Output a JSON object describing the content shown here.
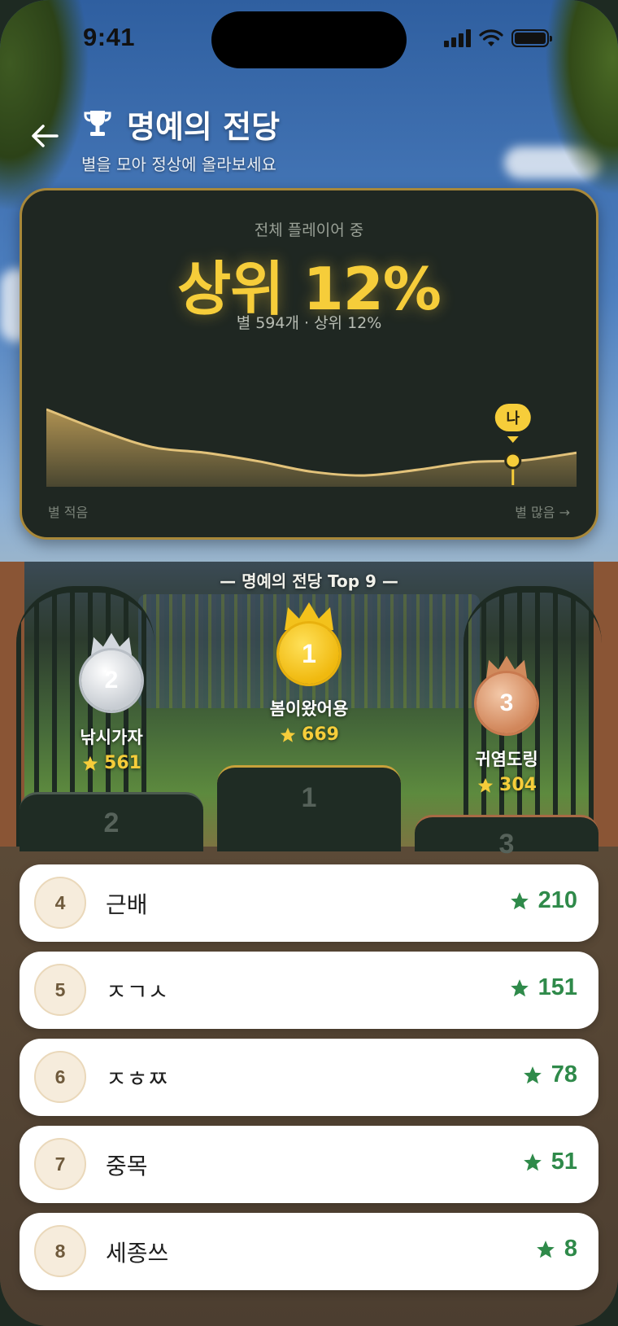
{
  "status": {
    "time": "9:41"
  },
  "header": {
    "title": "명예의 전당",
    "subtitle": "별을 모아 정상에 올라보세요"
  },
  "my_rank": {
    "caption": "전체 플레이어 중",
    "headline": "상위 12%",
    "detail": "별 594개 · 상위 12%",
    "marker_label": "나",
    "axis_left": "별 적음",
    "axis_right": "별 많음 →",
    "my_position": 0.88
  },
  "chart_data": {
    "type": "area",
    "x": [
      0,
      0.1,
      0.2,
      0.3,
      0.4,
      0.5,
      0.6,
      0.7,
      0.8,
      0.9,
      1.0
    ],
    "values": [
      0.82,
      0.6,
      0.42,
      0.36,
      0.27,
      0.16,
      0.12,
      0.18,
      0.26,
      0.28,
      0.36
    ],
    "xlabel": "",
    "ylabel": "",
    "color": "#c8a45a"
  },
  "top_section": {
    "label": "— 명예의 전당 Top 9 —"
  },
  "podium": [
    {
      "rank": "1",
      "name": "봄이왔어용",
      "score": "669",
      "color": "#f0b90f"
    },
    {
      "rank": "2",
      "name": "낚시가자",
      "score": "561",
      "color": "#c7ccd2"
    },
    {
      "rank": "3",
      "name": "귀염도링",
      "score": "304",
      "color": "#d1865a"
    }
  ],
  "ranking": [
    {
      "rank": "4",
      "name": "근배",
      "score": "210"
    },
    {
      "rank": "5",
      "name": "ㅈㄱㅅ",
      "score": "151"
    },
    {
      "rank": "6",
      "name": "ㅈㅎㅉ",
      "score": "78"
    },
    {
      "rank": "7",
      "name": "중목",
      "score": "51"
    },
    {
      "rank": "8",
      "name": "세종쓰",
      "score": "8"
    }
  ],
  "colors": {
    "accent_gold": "#f6cd3a",
    "score_green": "#2f8a4a",
    "card_border": "#a8883a"
  }
}
